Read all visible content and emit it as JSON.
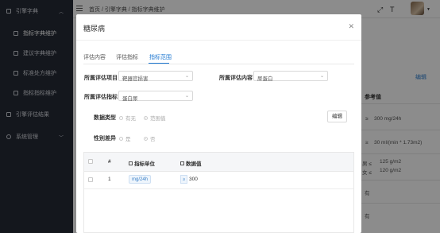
{
  "sidebar": {
    "items": [
      {
        "label": "引擎字典"
      },
      {
        "label": "指标字典维护"
      },
      {
        "label": "建议字典维护"
      },
      {
        "label": "标准处方维护"
      },
      {
        "label": "指标指标维护"
      },
      {
        "label": "引擎评估结果"
      },
      {
        "label": "系统管理"
      }
    ]
  },
  "topbar": {
    "breadcrumb": "首页 / 引擎字典 / 指标字典维护",
    "icons": [
      "fullscreen-icon",
      "text-size-icon"
    ]
  },
  "background": {
    "edit_link": "编辑",
    "ref_header": "参考值",
    "rows": [
      {
        "prefix": "≥",
        "text": "300 mg/24h"
      },
      {
        "prefix": "≥",
        "text": "30 ml/(min * 1.73m2)"
      },
      {
        "prefix": "男 ≤",
        "text": "125 g/m2"
      },
      {
        "prefix": "女 ≤",
        "text": "120 g/m2"
      },
      {
        "prefix": "",
        "text": "有"
      },
      {
        "prefix": "",
        "text": "有"
      }
    ]
  },
  "modal": {
    "title": "糖尿病",
    "tabs": [
      "评估内容",
      "评估指标",
      "指标范围"
    ],
    "active_tab": "指标范围",
    "fields": {
      "project_label": "所属评估项目",
      "project_value": "靶器官损害",
      "content_label": "所属评估内容",
      "content_value": "尿蛋白",
      "indicator_label": "所属评估指标",
      "indicator_value": "蛋白尿",
      "datatype_label": "数据类型",
      "datatype_options": [
        "有无",
        "范围值"
      ],
      "datatype_selected": "范围值",
      "gender_label": "性别差异",
      "gender_options": [
        "是",
        "否"
      ],
      "gender_selected": "否"
    },
    "edit_button": "编辑",
    "table": {
      "headers": [
        "#",
        "指标单位",
        "数据值"
      ],
      "rows": [
        {
          "index": "1",
          "unit": "mg/24h",
          "op": "≥",
          "value": "300"
        }
      ]
    }
  },
  "colors": {
    "accent": "#1f78d1",
    "sidebar": "#252a36"
  }
}
